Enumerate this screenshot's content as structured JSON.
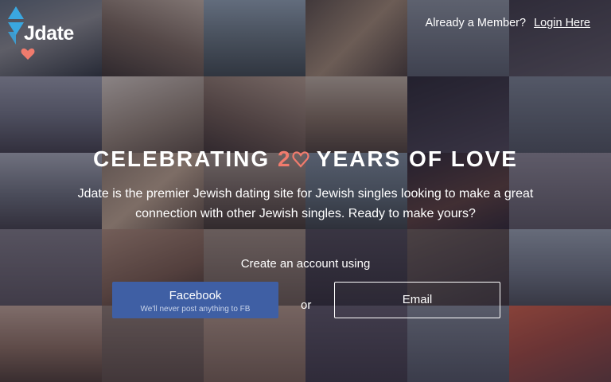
{
  "brand": {
    "name": "Jdate",
    "accent_color": "#f07b6d",
    "logo_blue": "#3aa7e0"
  },
  "nav": {
    "member_prompt": "Already a Member?",
    "login_label": "Login Here"
  },
  "hero": {
    "headline_before": "CELEBRATING ",
    "headline_accent": "2",
    "headline_accent_icon": "heart-icon",
    "headline_after": " YEARS OF LOVE",
    "tagline": "Jdate is the premier Jewish dating site for Jewish singles looking to make a great connection with other Jewish singles. Ready to make yours?"
  },
  "signup": {
    "prompt": "Create an account using",
    "facebook": {
      "label": "Facebook",
      "sublabel": "We'll never post anything to FB",
      "color": "#3f5fa4"
    },
    "separator": "or",
    "email_label": "Email"
  },
  "background": {
    "description_icon": "photo-grid",
    "overlay_color": "#201a2c"
  }
}
